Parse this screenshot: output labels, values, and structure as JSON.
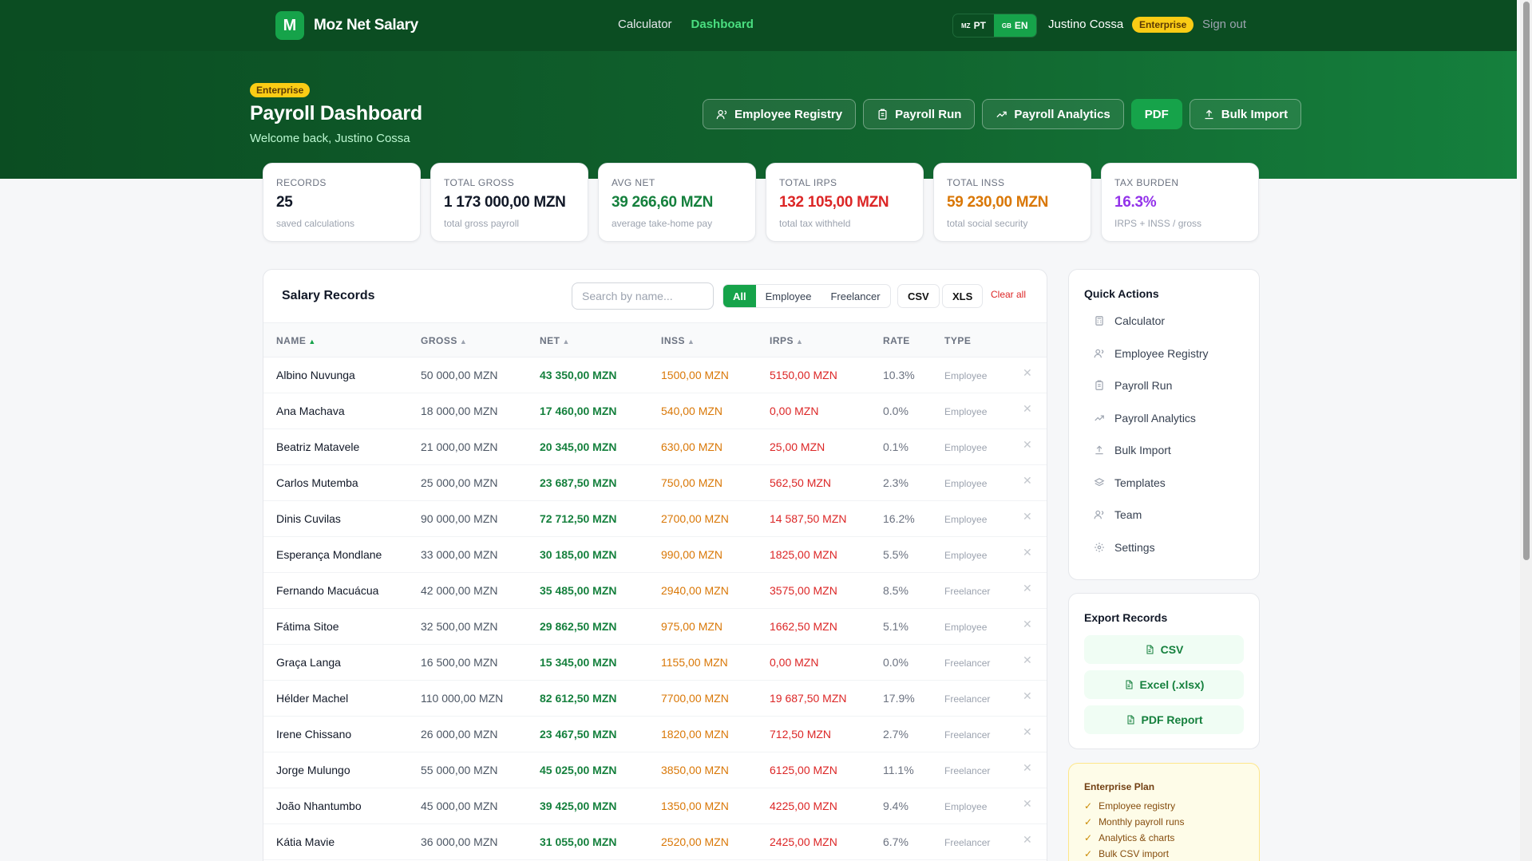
{
  "nav": {
    "brand_logo": "M",
    "brand_name": "Moz Net Salary",
    "links": [
      "Calculator",
      "Dashboard"
    ],
    "lang_pt_flag": "MZ",
    "lang_pt": "PT",
    "lang_en_flag": "GB",
    "lang_en": "EN",
    "user": "Justino Cossa",
    "plan": "Enterprise",
    "signout": "Sign out"
  },
  "hero": {
    "badge": "Enterprise",
    "title": "Payroll Dashboard",
    "subtitle": "Welcome back, Justino Cossa",
    "actions": [
      "Employee Registry",
      "Payroll Run",
      "Payroll Analytics",
      "PDF",
      "Bulk Import"
    ]
  },
  "stats": [
    {
      "label": "RECORDS",
      "value": "25",
      "sub": "saved calculations",
      "color": "#111827"
    },
    {
      "label": "TOTAL GROSS",
      "value": "1 173 000,00 MZN",
      "sub": "total gross payroll",
      "color": "#111827"
    },
    {
      "label": "AVG NET",
      "value": "39 266,60 MZN",
      "sub": "average take-home pay",
      "color": "#15803d"
    },
    {
      "label": "TOTAL IRPS",
      "value": "132 105,00 MZN",
      "sub": "total tax withheld",
      "color": "#dc2626"
    },
    {
      "label": "TOTAL INSS",
      "value": "59 230,00 MZN",
      "sub": "total social security",
      "color": "#d97706"
    },
    {
      "label": "TAX BURDEN",
      "value": "16.3%",
      "sub": "IRPS + INSS / gross",
      "color": "#9333ea"
    }
  ],
  "records": {
    "title": "Salary Records",
    "search_placeholder": "Search by name...",
    "filters": [
      "All",
      "Employee",
      "Freelancer"
    ],
    "csv": "CSV",
    "xls": "XLS",
    "clear": "Clear all",
    "columns": [
      "NAME",
      "GROSS",
      "NET",
      "INSS",
      "IRPS",
      "RATE",
      "TYPE"
    ],
    "rows": [
      {
        "name": "Albino Nuvunga",
        "gross": "50 000,00 MZN",
        "net": "43 350,00 MZN",
        "inss": "1500,00 MZN",
        "irps": "5150,00 MZN",
        "rate": "10.3%",
        "type": "Employee"
      },
      {
        "name": "Ana Machava",
        "gross": "18 000,00 MZN",
        "net": "17 460,00 MZN",
        "inss": "540,00 MZN",
        "irps": "0,00 MZN",
        "rate": "0.0%",
        "type": "Employee"
      },
      {
        "name": "Beatriz Matavele",
        "gross": "21 000,00 MZN",
        "net": "20 345,00 MZN",
        "inss": "630,00 MZN",
        "irps": "25,00 MZN",
        "rate": "0.1%",
        "type": "Employee"
      },
      {
        "name": "Carlos Mutemba",
        "gross": "25 000,00 MZN",
        "net": "23 687,50 MZN",
        "inss": "750,00 MZN",
        "irps": "562,50 MZN",
        "rate": "2.3%",
        "type": "Employee"
      },
      {
        "name": "Dinis Cuvilas",
        "gross": "90 000,00 MZN",
        "net": "72 712,50 MZN",
        "inss": "2700,00 MZN",
        "irps": "14 587,50 MZN",
        "rate": "16.2%",
        "type": "Employee"
      },
      {
        "name": "Esperança Mondlane",
        "gross": "33 000,00 MZN",
        "net": "30 185,00 MZN",
        "inss": "990,00 MZN",
        "irps": "1825,00 MZN",
        "rate": "5.5%",
        "type": "Employee"
      },
      {
        "name": "Fernando Macuácua",
        "gross": "42 000,00 MZN",
        "net": "35 485,00 MZN",
        "inss": "2940,00 MZN",
        "irps": "3575,00 MZN",
        "rate": "8.5%",
        "type": "Freelancer"
      },
      {
        "name": "Fátima Sitoe",
        "gross": "32 500,00 MZN",
        "net": "29 862,50 MZN",
        "inss": "975,00 MZN",
        "irps": "1662,50 MZN",
        "rate": "5.1%",
        "type": "Employee"
      },
      {
        "name": "Graça Langa",
        "gross": "16 500,00 MZN",
        "net": "15 345,00 MZN",
        "inss": "1155,00 MZN",
        "irps": "0,00 MZN",
        "rate": "0.0%",
        "type": "Freelancer"
      },
      {
        "name": "Hélder Machel",
        "gross": "110 000,00 MZN",
        "net": "82 612,50 MZN",
        "inss": "7700,00 MZN",
        "irps": "19 687,50 MZN",
        "rate": "17.9%",
        "type": "Freelancer"
      },
      {
        "name": "Irene Chissano",
        "gross": "26 000,00 MZN",
        "net": "23 467,50 MZN",
        "inss": "1820,00 MZN",
        "irps": "712,50 MZN",
        "rate": "2.7%",
        "type": "Freelancer"
      },
      {
        "name": "Jorge Mulungo",
        "gross": "55 000,00 MZN",
        "net": "45 025,00 MZN",
        "inss": "3850,00 MZN",
        "irps": "6125,00 MZN",
        "rate": "11.1%",
        "type": "Freelancer"
      },
      {
        "name": "João Nhantumbo",
        "gross": "45 000,00 MZN",
        "net": "39 425,00 MZN",
        "inss": "1350,00 MZN",
        "irps": "4225,00 MZN",
        "rate": "9.4%",
        "type": "Employee"
      },
      {
        "name": "Kátia Mavie",
        "gross": "36 000,00 MZN",
        "net": "31 055,00 MZN",
        "inss": "2520,00 MZN",
        "irps": "2425,00 MZN",
        "rate": "6.7%",
        "type": "Freelancer"
      }
    ]
  },
  "quick_actions": {
    "title": "Quick Actions",
    "items": [
      {
        "label": "Calculator",
        "icon": "calculator-icon"
      },
      {
        "label": "Employee Registry",
        "icon": "users-icon"
      },
      {
        "label": "Payroll Run",
        "icon": "clipboard-icon"
      },
      {
        "label": "Payroll Analytics",
        "icon": "trending-up-icon"
      },
      {
        "label": "Bulk Import",
        "icon": "upload-icon"
      },
      {
        "label": "Templates",
        "icon": "layers-icon"
      },
      {
        "label": "Team",
        "icon": "team-icon"
      },
      {
        "label": "Settings",
        "icon": "gear-icon"
      }
    ]
  },
  "export": {
    "title": "Export Records",
    "buttons": [
      "CSV",
      "Excel (.xlsx)",
      "PDF Report"
    ]
  },
  "plan_card": {
    "title": "Enterprise Plan",
    "items": [
      "Employee registry",
      "Monthly payroll runs",
      "Analytics & charts",
      "Bulk CSV import"
    ]
  }
}
